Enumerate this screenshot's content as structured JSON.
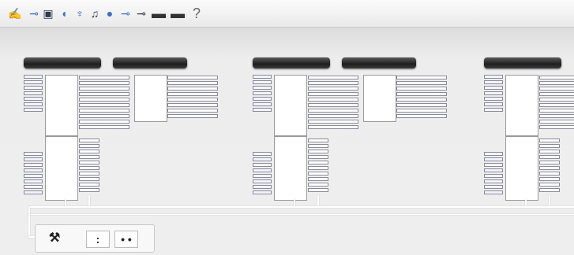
{
  "toolbar": {
    "items": [
      {
        "icon": "wrench-icon",
        "glyph": "✍"
      },
      {
        "icon": "cable-icon",
        "glyph": "⊸"
      },
      {
        "icon": "save-icon",
        "glyph": "▣"
      },
      {
        "icon": "speaker-icon",
        "glyph": "◖"
      },
      {
        "icon": "antenna-icon",
        "glyph": "♆"
      },
      {
        "icon": "music-note-icon",
        "glyph": "♫"
      },
      {
        "icon": "disc-icon",
        "glyph": "●"
      },
      {
        "icon": "plug-icon",
        "glyph": "⊸"
      },
      {
        "icon": "plug-alt-icon",
        "glyph": "⊸"
      },
      {
        "icon": "device-a-icon",
        "glyph": "▬"
      },
      {
        "icon": "device-b-icon",
        "glyph": "▬"
      },
      {
        "icon": "help-icon",
        "glyph": "?"
      }
    ]
  },
  "colors": {
    "toolbar_icon_primary": "#3c6fc2",
    "toolbar_icon_secondary": "#2f3a4c",
    "module_text": "#3535b5",
    "header_bar": "#2a2a2a"
  },
  "units": [
    {
      "header_main": "",
      "header_sub": "",
      "main_title": "",
      "main_subtitle": "",
      "aux_title": "",
      "aux_ports": [
        "",
        "",
        "",
        "",
        "",
        "",
        "",
        ""
      ],
      "outputs": [
        "",
        "",
        "",
        "",
        "",
        "",
        "",
        "",
        "",
        ""
      ],
      "inputs": [
        "",
        "",
        "",
        "",
        "",
        "",
        ""
      ],
      "lower_title": "",
      "lower_title2": "",
      "lower_inputs": [
        "",
        "",
        "",
        "",
        "",
        "",
        "",
        ""
      ],
      "lower_outputs": [
        "",
        "",
        "",
        "",
        "",
        "",
        "",
        "",
        "",
        ""
      ]
    },
    {
      "header_main": "",
      "header_sub": "",
      "main_title": "",
      "main_subtitle": "",
      "aux_title": "",
      "aux_ports": [
        "",
        "",
        "",
        "",
        "",
        "",
        "",
        ""
      ],
      "outputs": [
        "",
        "",
        "",
        "",
        "",
        "",
        "",
        "",
        "",
        ""
      ],
      "inputs": [
        "",
        "",
        "",
        "",
        "",
        "",
        ""
      ],
      "lower_title": "",
      "lower_title2": "",
      "lower_inputs": [
        "",
        "",
        "",
        "",
        "",
        "",
        "",
        ""
      ],
      "lower_outputs": [
        "",
        "",
        "",
        "",
        "",
        "",
        "",
        "",
        "",
        ""
      ]
    },
    {
      "header_main": "",
      "header_sub": "",
      "main_title": "",
      "main_subtitle": "",
      "aux_title": "",
      "aux_ports": [],
      "outputs": [
        "",
        "",
        "",
        "",
        "",
        "",
        "",
        "",
        "",
        ""
      ],
      "inputs": [
        "",
        "",
        "",
        "",
        "",
        "",
        ""
      ],
      "lower_title": "",
      "lower_title2": "",
      "lower_inputs": [
        "",
        "",
        "",
        "",
        "",
        "",
        "",
        ""
      ],
      "lower_outputs": [
        "",
        "",
        "",
        "",
        "",
        "",
        "",
        "",
        "",
        ""
      ]
    }
  ],
  "bottom_panel": {
    "label": "",
    "items": [
      {
        "icon": "mixer-icon",
        "glyph": "⚒"
      },
      {
        "icon": "port-pair-icon",
        "glyph": ":"
      },
      {
        "icon": "dual-jack-icon",
        "glyph": "• •"
      }
    ]
  }
}
